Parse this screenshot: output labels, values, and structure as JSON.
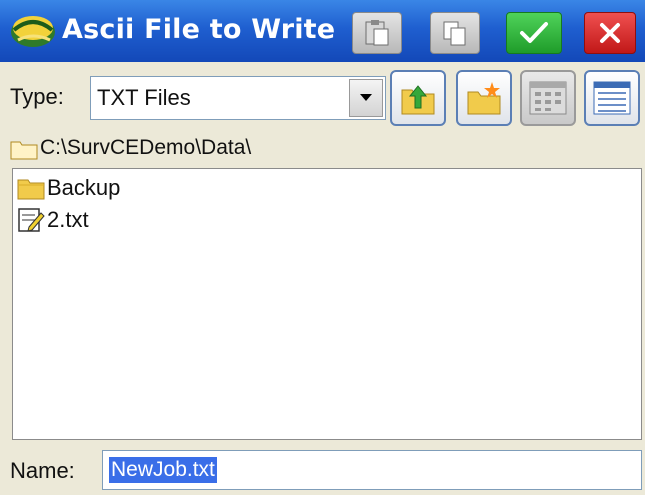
{
  "window": {
    "title": "Ascii File to Write"
  },
  "title_buttons": {
    "paste": {
      "icon": "paste-icon"
    },
    "copy": {
      "icon": "copy-icon"
    },
    "ok": {
      "icon": "checkmark-icon",
      "color": "#22a32e"
    },
    "cancel": {
      "icon": "close-icon",
      "color": "#d42222"
    }
  },
  "type_row": {
    "label": "Type:",
    "selected": "TXT Files",
    "buttons": [
      "folder-up-icon",
      "new-folder-icon",
      "list-view-icon",
      "details-view-icon"
    ]
  },
  "path": {
    "text": "C:\\SurvCEDemo\\Data\\"
  },
  "files": [
    {
      "name": "Backup",
      "icon": "folder-icon"
    },
    {
      "name": "2.txt",
      "icon": "text-file-icon"
    }
  ],
  "name_row": {
    "label": "Name:",
    "value": "NewJob.txt"
  },
  "colors": {
    "titlebar": "#1f5fd0",
    "selection": "#3a6ee8"
  }
}
